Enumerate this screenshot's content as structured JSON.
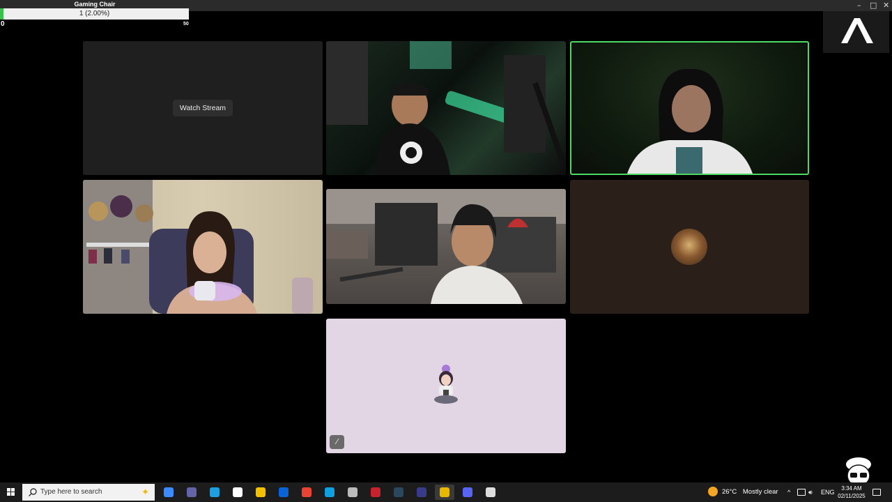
{
  "window": {
    "minimize_glyph": "–",
    "maximize_glyph": "□",
    "close_glyph": "✕"
  },
  "goal": {
    "title": "Gaming Chair",
    "progress_text": "1 (2.00%)",
    "progress_fraction": 0.02,
    "min_label": "0",
    "max_label": "50",
    "fill_color": "#36c34b"
  },
  "overlay_logo": {
    "icon": "streamer-logo-icon"
  },
  "tiles": [
    {
      "name": "stream-tile",
      "button_label": "Watch Stream"
    },
    {
      "name": "participant-camera-1",
      "icon": "webcam-video"
    },
    {
      "name": "participant-camera-2",
      "icon": "webcam-video",
      "speaking": true,
      "speaking_color": "#4cd964"
    },
    {
      "name": "participant-camera-3",
      "icon": "webcam-video"
    },
    {
      "name": "participant-camera-4",
      "icon": "webcam-video"
    },
    {
      "name": "participant-avatar-1",
      "icon": "avatar-image",
      "bg_color": "#2a1f19"
    },
    {
      "name": "participant-avatar-2",
      "icon": "avatar-image",
      "bg_color": "#e2d6e4",
      "muted_icon": "mic-muted-icon",
      "muted_glyph": "⁄"
    }
  ],
  "taskbar": {
    "start_icon": "windows-start-icon",
    "search_placeholder": "Type here to search",
    "apps": [
      {
        "icon": "copilot-icon",
        "color": "#3b8cff"
      },
      {
        "icon": "teams-icon",
        "color": "#6264a7"
      },
      {
        "icon": "edge-icon",
        "color": "#1ba1e2"
      },
      {
        "icon": "store-icon",
        "color": "#ffffff"
      },
      {
        "icon": "file-explorer-icon",
        "color": "#f2c200"
      },
      {
        "icon": "outlook-icon",
        "color": "#0a64d6"
      },
      {
        "icon": "chrome-icon",
        "color": "#ea4335"
      },
      {
        "icon": "app-blue-icon",
        "color": "#0fa0e0"
      },
      {
        "icon": "app-chat-icon",
        "color": "#bbbbbb"
      },
      {
        "icon": "app-red-icon",
        "color": "#c8232c"
      },
      {
        "icon": "steam-icon",
        "color": "#2a475e"
      },
      {
        "icon": "app-circle-icon",
        "color": "#3a3a8a"
      },
      {
        "icon": "app-active-icon",
        "color": "#e6b800",
        "active": true
      },
      {
        "icon": "discord-icon",
        "color": "#5865f2"
      },
      {
        "icon": "obs-icon",
        "color": "#dddddd"
      }
    ],
    "weather": {
      "icon": "weather-moon-icon",
      "temp": "26°C",
      "text": "Mostly clear"
    },
    "tray": {
      "chevron": "^",
      "lang": "ENG"
    },
    "clock": {
      "time": "3:34 AM",
      "date": "02/11/2025"
    }
  }
}
